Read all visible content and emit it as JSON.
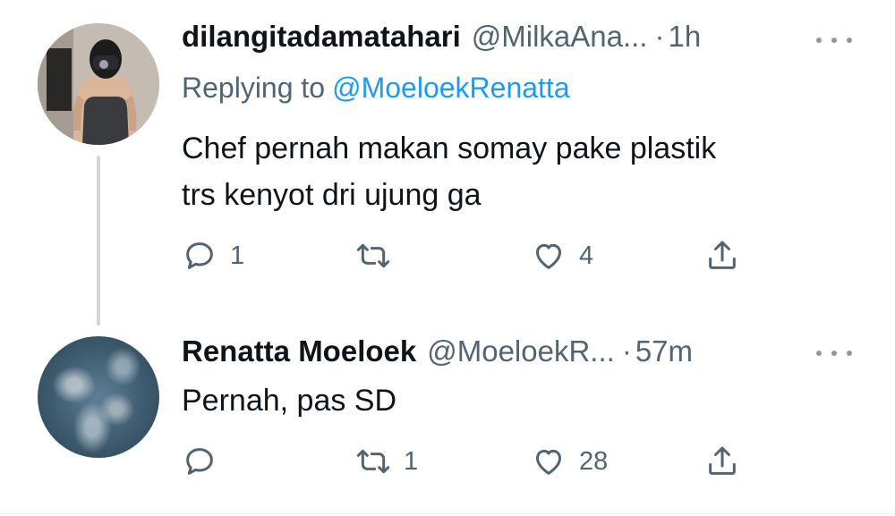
{
  "tweets": [
    {
      "display_name": "dilangitadamatahari",
      "handle": "@MilkaAna...",
      "dot": "·",
      "time": "1h",
      "replying_prefix": "Replying to",
      "replying_to": "@MoeloekRenatta",
      "text_line1": "Chef pernah makan somay pake plastik",
      "text_line2": "trs kenyot dri ujung ga",
      "reply_count": "1",
      "retweet_count": "",
      "like_count": "4"
    },
    {
      "display_name": "Renatta Moeloek",
      "handle": "@MoeloekR...",
      "dot": "·",
      "time": "57m",
      "text_line1": "Pernah, pas SD",
      "reply_count": "",
      "retweet_count": "1",
      "like_count": "28"
    }
  ],
  "icons": {
    "reply": "reply-icon",
    "retweet": "retweet-icon",
    "like": "heart-icon",
    "share": "share-icon",
    "more": "more-icon"
  },
  "colors": {
    "text": "#0f1419",
    "secondary": "#536471",
    "link": "#1d9bf0",
    "thread_line": "#cfd9de"
  }
}
